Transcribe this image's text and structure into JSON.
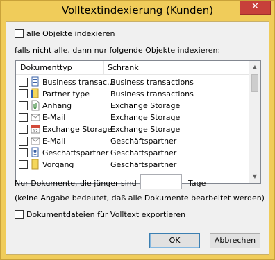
{
  "window": {
    "title": "Volltextindexierung (Kunden)",
    "close_glyph": "✕"
  },
  "options": {
    "all_objects_label": "alle Objekte indexieren",
    "filter_label": "falls nicht alle, dann nur folgende Objekte indexieren:"
  },
  "list": {
    "col_type": "Dokumenttyp",
    "col_store": "Schrank",
    "rows": [
      {
        "type": "Business transac...",
        "store": "Business transactions",
        "icon": "business-transaction-icon"
      },
      {
        "type": "Partner type",
        "store": "Business transactions",
        "icon": "partner-type-icon"
      },
      {
        "type": "Anhang",
        "store": "Exchange Storage",
        "icon": "attachment-icon"
      },
      {
        "type": "E-Mail",
        "store": "Exchange Storage",
        "icon": "email-icon"
      },
      {
        "type": "Exchange Storage",
        "store": "Exchange Storage",
        "icon": "calendar-icon"
      },
      {
        "type": "E-Mail",
        "store": "Geschäftspartner",
        "icon": "email-icon"
      },
      {
        "type": "Geschäftspartner",
        "store": "Geschäftspartner",
        "icon": "business-partner-icon"
      },
      {
        "type": "Vorgang",
        "store": "Geschäftspartner",
        "icon": "folder-icon"
      }
    ]
  },
  "age_filter": {
    "prefix": "Nur Dokumente, die jünger sind als",
    "value": "",
    "suffix": "Tage",
    "hint": "(keine Angabe bedeutet, daß alle Dokumente bearbeitet werden)"
  },
  "export": {
    "label": "Dokumentdateien für Volltext exportieren"
  },
  "buttons": {
    "ok": "OK",
    "cancel": "Abbrechen"
  },
  "colors": {
    "frame": "#f0cc5a",
    "close": "#c7403a",
    "dialog_bg": "#f0f0f0"
  }
}
